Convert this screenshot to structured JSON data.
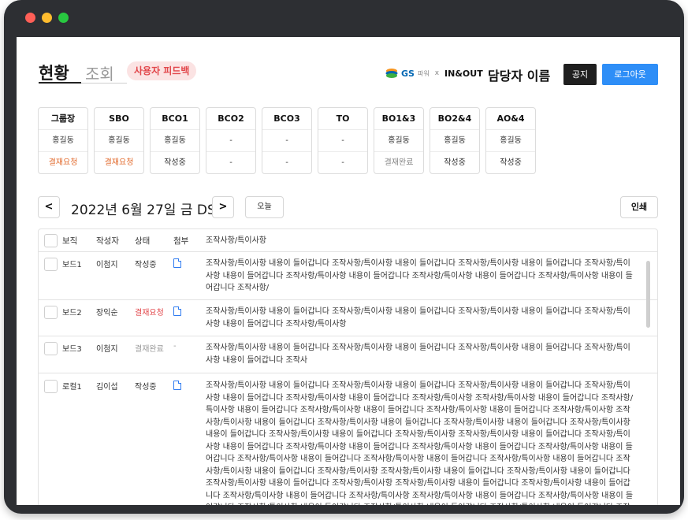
{
  "header": {
    "tab_active": "현황",
    "tab_inactive": "조회",
    "feedback_label": "사용자 피드백",
    "brand": {
      "gs": "GS",
      "sub": "파워",
      "x": "x",
      "inout": "IN&OUT"
    },
    "manager_name": "담당자 이름",
    "notice_label": "공지",
    "logout_label": "로그아웃"
  },
  "status_cards": [
    {
      "title": "그룹장",
      "name": "홍길동",
      "status": "결재요청",
      "kind": "req"
    },
    {
      "title": "SBO",
      "name": "홍길동",
      "status": "결재요청",
      "kind": "req"
    },
    {
      "title": "BCO1",
      "name": "홍길동",
      "status": "작성중",
      "kind": "normal"
    },
    {
      "title": "BCO2",
      "name": "-",
      "status": "-",
      "kind": "normal"
    },
    {
      "title": "BCO3",
      "name": "-",
      "status": "-",
      "kind": "normal"
    },
    {
      "title": "TO",
      "name": "-",
      "status": "-",
      "kind": "normal"
    },
    {
      "title": "BO1&3",
      "name": "홍길동",
      "status": "결재완료",
      "kind": "done"
    },
    {
      "title": "BO2&4",
      "name": "홍길동",
      "status": "작성중",
      "kind": "normal"
    },
    {
      "title": "AO&4",
      "name": "홍길동",
      "status": "작성중",
      "kind": "normal"
    }
  ],
  "datebar": {
    "prev": "<",
    "next": ">",
    "date": "2022년 6월 27일 금 DS",
    "today": "오늘",
    "print": "인쇄"
  },
  "table": {
    "headers": {
      "board": "보직",
      "writer": "작성자",
      "state": "상태",
      "attach": "첨부",
      "text": "조작사항/특이사항"
    },
    "rows": [
      {
        "board": "보드1",
        "writer": "이첨지",
        "state": "작성중",
        "state_kind": "normal",
        "attach": "file",
        "text": "조작사항/특이사항 내용이 들어갑니다 조작사항/특이사항 내용이 들어갑니다 조작사항/특이사항 내용이 들어갑니다 조작사항/특이사항 내용이 들어갑니다 조작사항/특이사항 내용이 들어갑니다 조작사항/특이사항 내용이 들어갑니다 조작사항/특이사항 내용이 들어갑니다 조작사항/"
      },
      {
        "board": "보드2",
        "writer": "장익순",
        "state": "결재요청",
        "state_kind": "req",
        "attach": "file",
        "text": "조작사항/특이사항 내용이 들어갑니다 조작사항/특이사항 내용이 들어갑니다 조작사항/특이사항 내용이 들어갑니다 조작사항/특이사항 내용이 들어갑니다 조작사항/특이사항"
      },
      {
        "board": "보드3",
        "writer": "이첨지",
        "state": "결재완료",
        "state_kind": "done",
        "attach": "-",
        "text": "조작사항/특이사항 내용이 들어갑니다 조작사항/특이사항 내용이 들어갑니다 조작사항/특이사항 내용이 들어갑니다 조작사항/특이사항 내용이 들어갑니다 조작사"
      },
      {
        "board": "로컬1",
        "writer": "김이섭",
        "state": "작성중",
        "state_kind": "normal",
        "attach": "file",
        "text": "조작사항/특이사항 내용이 들어갑니다 조작사항/특이사항 내용이 들어갑니다 조작사항/특이사항 내용이 들어갑니다 조작사항/특이사항 내용이 들어갑니다 조작사항/특이사항 내용이 들어갑니다 조작사항/특이사항 조작사항/특이사항 내용이 들어갑니다 조작사항/특이사항 내용이 들어갑니다 조작사항/특이사항 내용이 들어갑니다 조작사항/특이사항 내용이 들어갑니다 조작사항/특이사항 조작사항/특이사항 내용이 들어갑니다 조작사항/특이사항 내용이 들어갑니다 조작사항/특이사항 내용이 들어갑니다 조작사항/특이사항 내용이 들어갑니다 조작사항/특이사항 내용이 들어갑니다 조작사항/특이사항 조작사항/특이사항 내용이 들어갑니다 조작사항/특이사항 내용이 들어갑니다 조작사항/특이사항 내용이 들어갑니다 조작사항/특이사항 내용이 들어갑니다 조작사항/특이사항 내용이 들어갑니다 조작사항/특이사항 내용이 들어갑니다 조작사항/특이사항 내용이 들어갑니다 조작사항/특이사항 내용이 들어갑니다 조작사항/특이사항 내용이 들어갑니다 조작사항/특이사항 조작사항/특이사항 내용이 들어갑니다 조작사항/특이사항 내용이 들어갑니다 조작사항/특이사항 내용이 들어갑니다 조작사항/특이사항 조작사항/특이사항 내용이 들어갑니다 조작사항/특이사항 내용이 들어갑니다 조작사항/특이사항 내용이 들어갑니다 조작사항/특이사항 조작사항/특이사항 내용이 들어갑니다 조작사항/특이사항 내용이 들어갑니다 조작사항/특이사항 내용이 들어갑니다 조작사항/특이사항 내용이 들어갑니다 조작사항/특이사항 내용이 들어갑니다 조작사항/특이사항 내용이 들어갑니다 조작사항/특이사항 내용"
      }
    ]
  },
  "colors": {
    "frame": "#2d2f33",
    "dot_red": "#ff5f57",
    "dot_yellow": "#febc2e",
    "dot_green": "#28c840",
    "accent_blue": "#2e8ef7",
    "request_orange": "#e26a2c",
    "request_red": "#e2474b"
  }
}
